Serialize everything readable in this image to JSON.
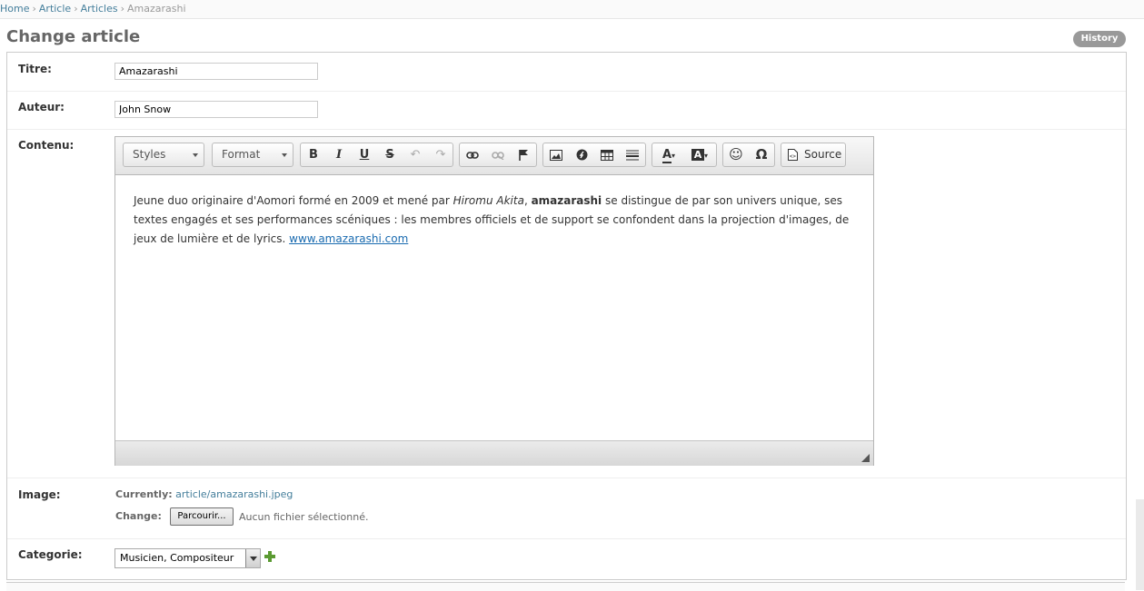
{
  "breadcrumbs": {
    "home": "Home",
    "app": "Article",
    "model": "Articles",
    "current": "Amazarashi",
    "separator": "›"
  },
  "page": {
    "title": "Change article",
    "history_label": "History"
  },
  "fields": {
    "titre": {
      "label": "Titre:",
      "value": "Amazarashi"
    },
    "auteur": {
      "label": "Auteur:",
      "value": "John Snow"
    },
    "contenu": {
      "label": "Contenu:",
      "toolbar": {
        "styles_label": "Styles",
        "format_label": "Format",
        "source_label": "Source"
      },
      "content": {
        "part1": "Jeune duo originaire d'Aomori formé en 2009 et mené par ",
        "italic": "Hiromu Akita",
        "part2": ", ",
        "bold": "amazarashi",
        "part3": " se distingue de par son univers unique, ses textes engagés et ses performances scéniques : les membres officiels et de support se confondent dans la projection d'images, de jeux de lumière et de lyrics. ",
        "link": "www.amazarashi.com"
      }
    },
    "image": {
      "label": "Image:",
      "currently_label": "Currently:",
      "current_file": "article/amazarashi.jpeg",
      "change_label": "Change:",
      "browse_label": "Parcourir...",
      "no_file_text": "Aucun fichier sélectionné."
    },
    "categorie": {
      "label": "Categorie:",
      "selected": "Musicien, Compositeur"
    }
  },
  "colors": {
    "link": "#447e9b",
    "history_bg": "#999999",
    "add_icon": "#5b9a32"
  }
}
